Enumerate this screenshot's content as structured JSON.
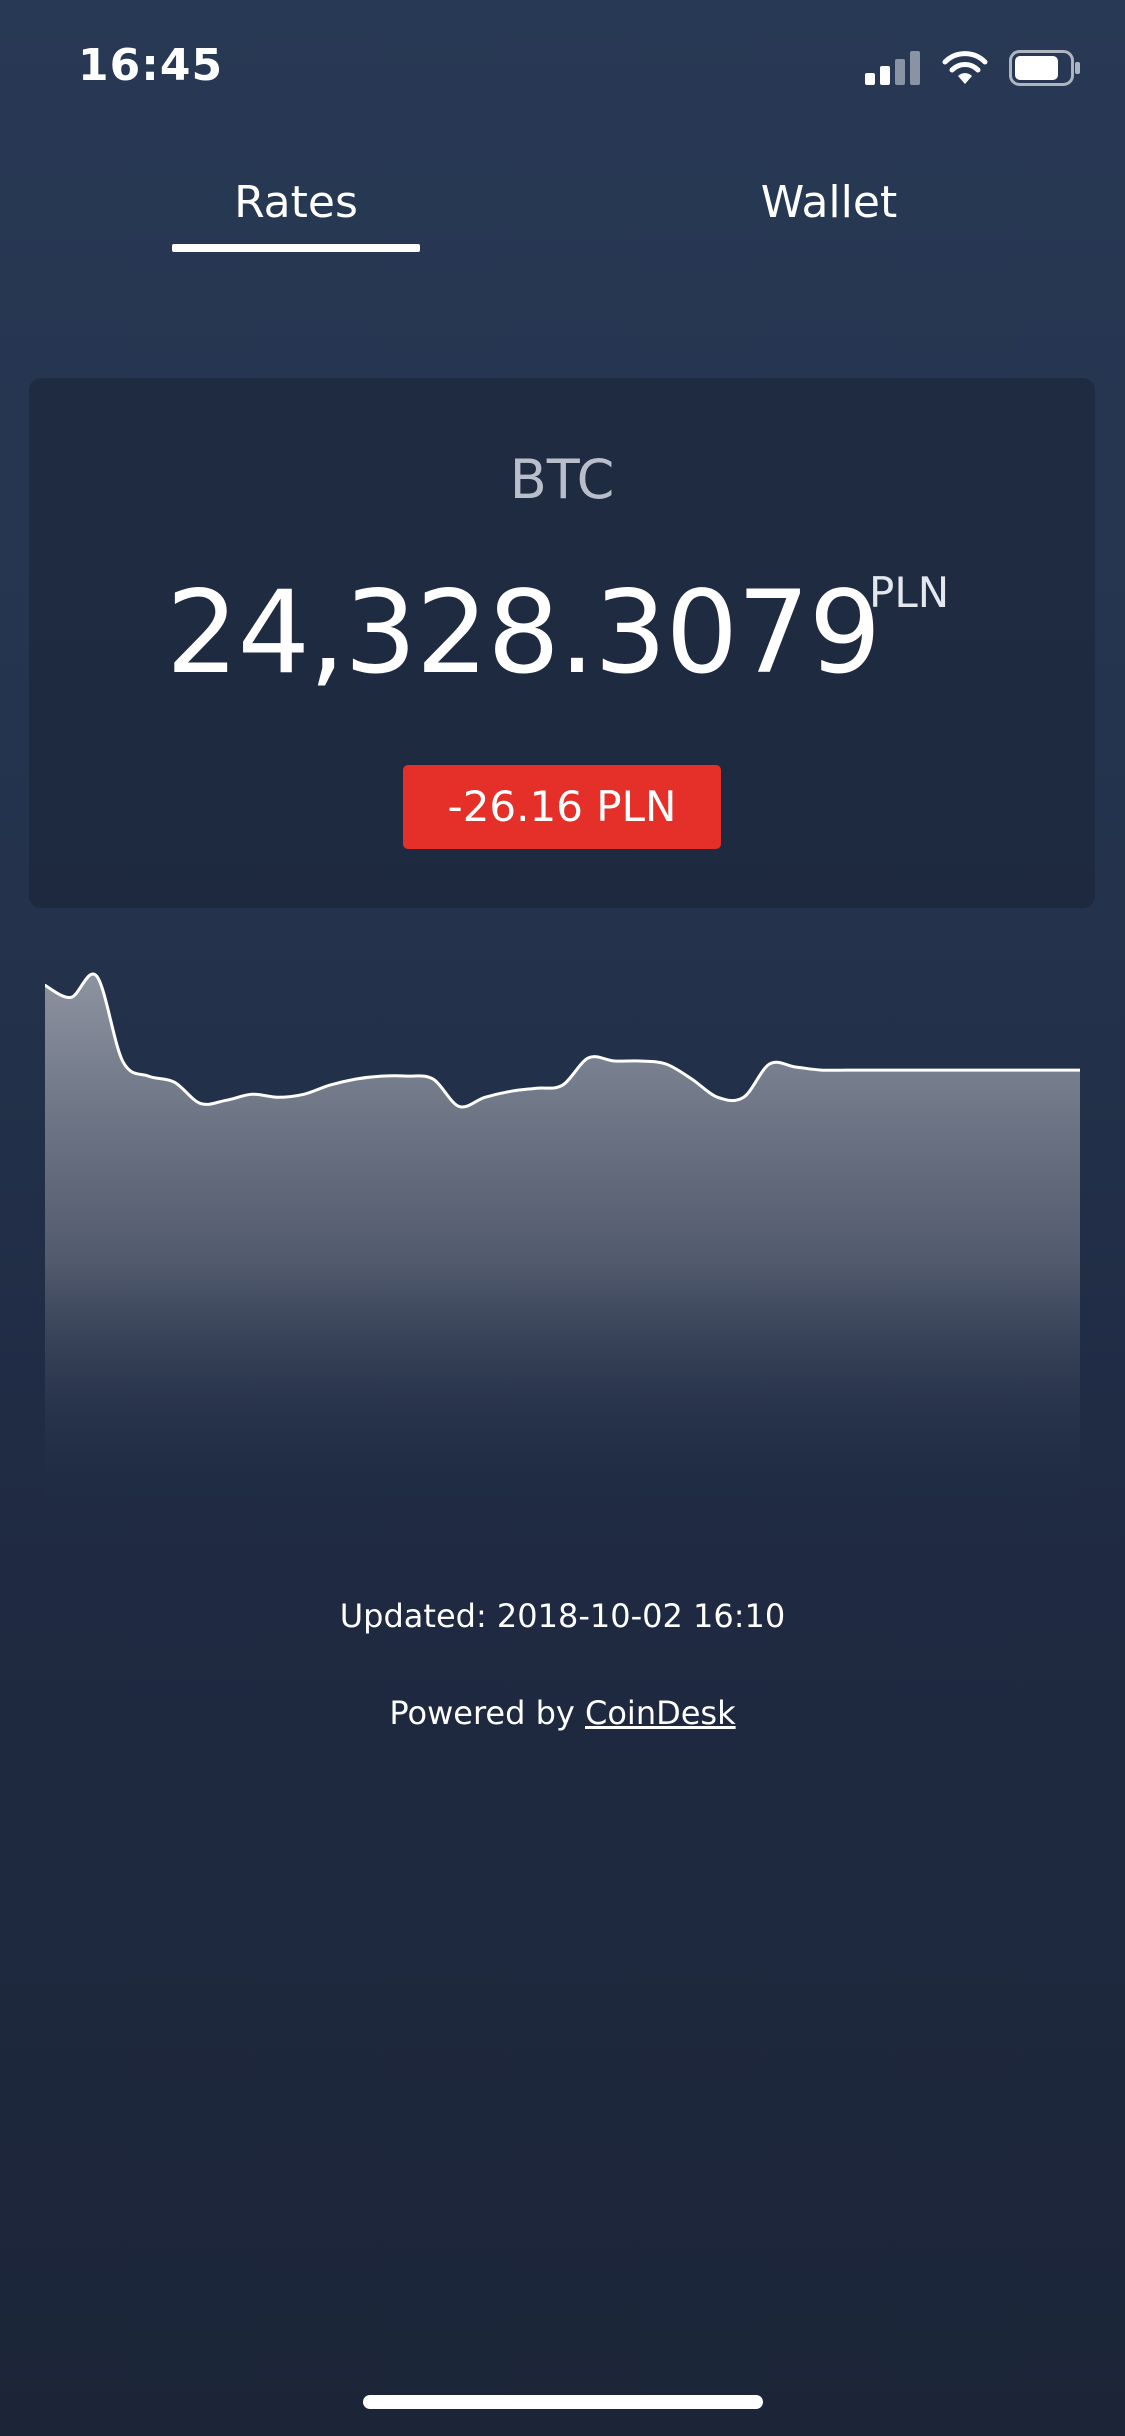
{
  "status_bar": {
    "time": "16:45",
    "icons": [
      "signal-icon",
      "wifi-icon",
      "battery-icon"
    ],
    "battery_level": 0.75
  },
  "tabs": [
    {
      "label": "Rates",
      "active": true
    },
    {
      "label": "Wallet",
      "active": false
    }
  ],
  "rate_card": {
    "currency": "BTC",
    "price": "24,328.3079",
    "price_currency": "PLN",
    "change": "-26.16 PLN",
    "change_color": "#e5302a"
  },
  "chart_data": {
    "type": "area",
    "title": "",
    "xlabel": "",
    "ylabel": "",
    "grid": false,
    "line_color": "#ffffff",
    "fill_color_top": "#8d93a0",
    "x": [
      0,
      1,
      2,
      3,
      4,
      5,
      6,
      7,
      8,
      9,
      10,
      11,
      12,
      13,
      14,
      15,
      16,
      17,
      18,
      19,
      20,
      21,
      22,
      23,
      24,
      25,
      26,
      27,
      28,
      29,
      30,
      31,
      32,
      33,
      34,
      35,
      36,
      37,
      38,
      39,
      40
    ],
    "values": [
      24370,
      24366,
      24373,
      24345,
      24340,
      24338,
      24331,
      24332,
      24334,
      24333,
      24334,
      24337,
      24339,
      24340,
      24340,
      24339,
      24330,
      24333,
      24335,
      24336,
      24337,
      24346,
      24345,
      24345,
      24344,
      24339,
      24333,
      24333,
      24344,
      24343,
      24342,
      24342,
      24342,
      24342,
      24342,
      24342,
      24342,
      24342,
      24342,
      24342,
      24342
    ],
    "ylim": [
      24200,
      24380
    ]
  },
  "footer": {
    "updated": "Updated: 2018-10-02 16:10",
    "powered_prefix": "Powered by ",
    "powered_link": "CoinDesk"
  },
  "colors": {
    "background": "#25344e",
    "card": "#1f2a3f",
    "accent_negative": "#e5302a"
  }
}
